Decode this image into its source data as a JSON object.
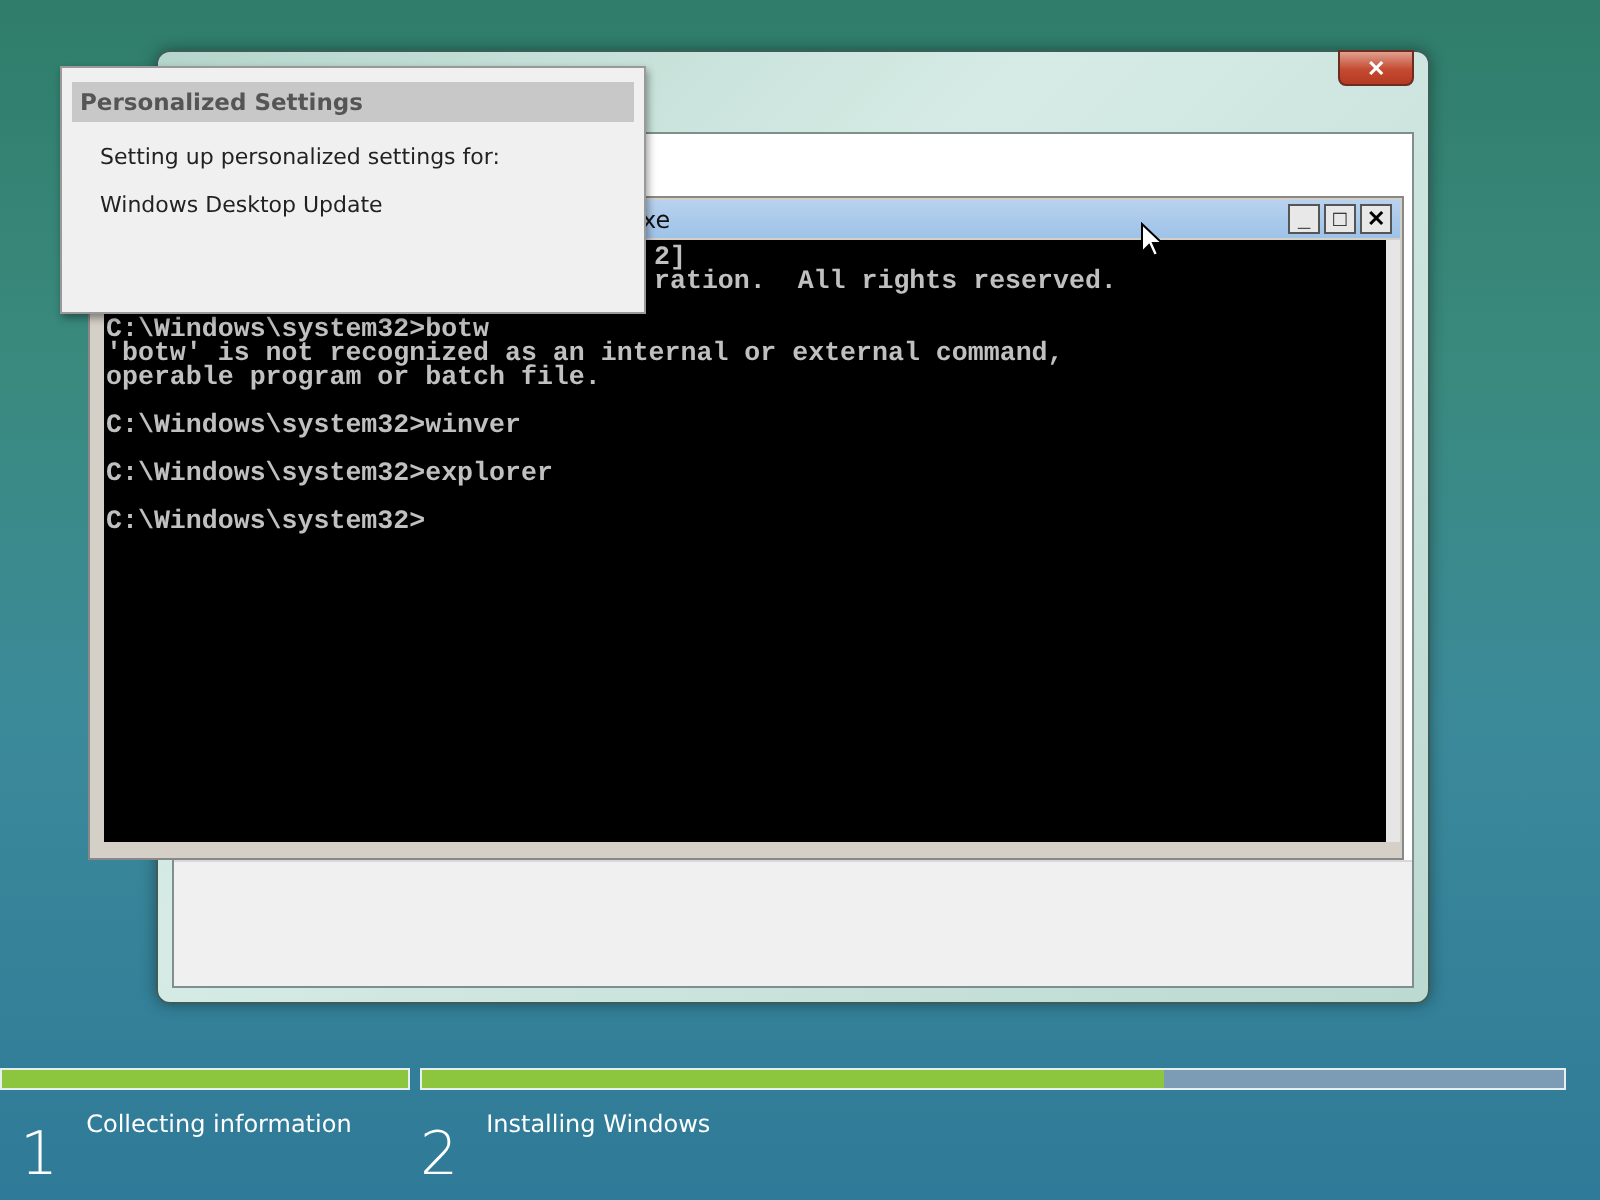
{
  "setup_window": {
    "close_button": "✕"
  },
  "console_window": {
    "title": "xe",
    "buttons": [
      "_",
      "□",
      "✕"
    ],
    "lines": [
      {
        "text": "2]",
        "kind": "partial"
      },
      {
        "text": "ration.  All rights reserved.",
        "kind": "partial"
      },
      {
        "kind": "blank"
      },
      {
        "text": "C:\\Windows\\system32>botw",
        "kind": "full"
      },
      {
        "text": "'botw' is not recognized as an internal or external command,",
        "kind": "full"
      },
      {
        "text": "operable program or batch file.",
        "kind": "full"
      },
      {
        "kind": "blank"
      },
      {
        "text": "C:\\Windows\\system32>winver",
        "kind": "full"
      },
      {
        "kind": "blank"
      },
      {
        "text": "C:\\Windows\\system32>explorer",
        "kind": "full"
      },
      {
        "kind": "blank"
      },
      {
        "text": "C:\\Windows\\system32>",
        "kind": "full"
      }
    ]
  },
  "popup": {
    "title": "Personalized Settings",
    "message": "Setting up personalized settings for:",
    "item": "Windows Desktop Update"
  },
  "steps": [
    {
      "number": "1",
      "label": "Collecting information",
      "level": 1
    },
    {
      "number": "2",
      "label": "Installing Windows",
      "level": 0.65
    }
  ]
}
